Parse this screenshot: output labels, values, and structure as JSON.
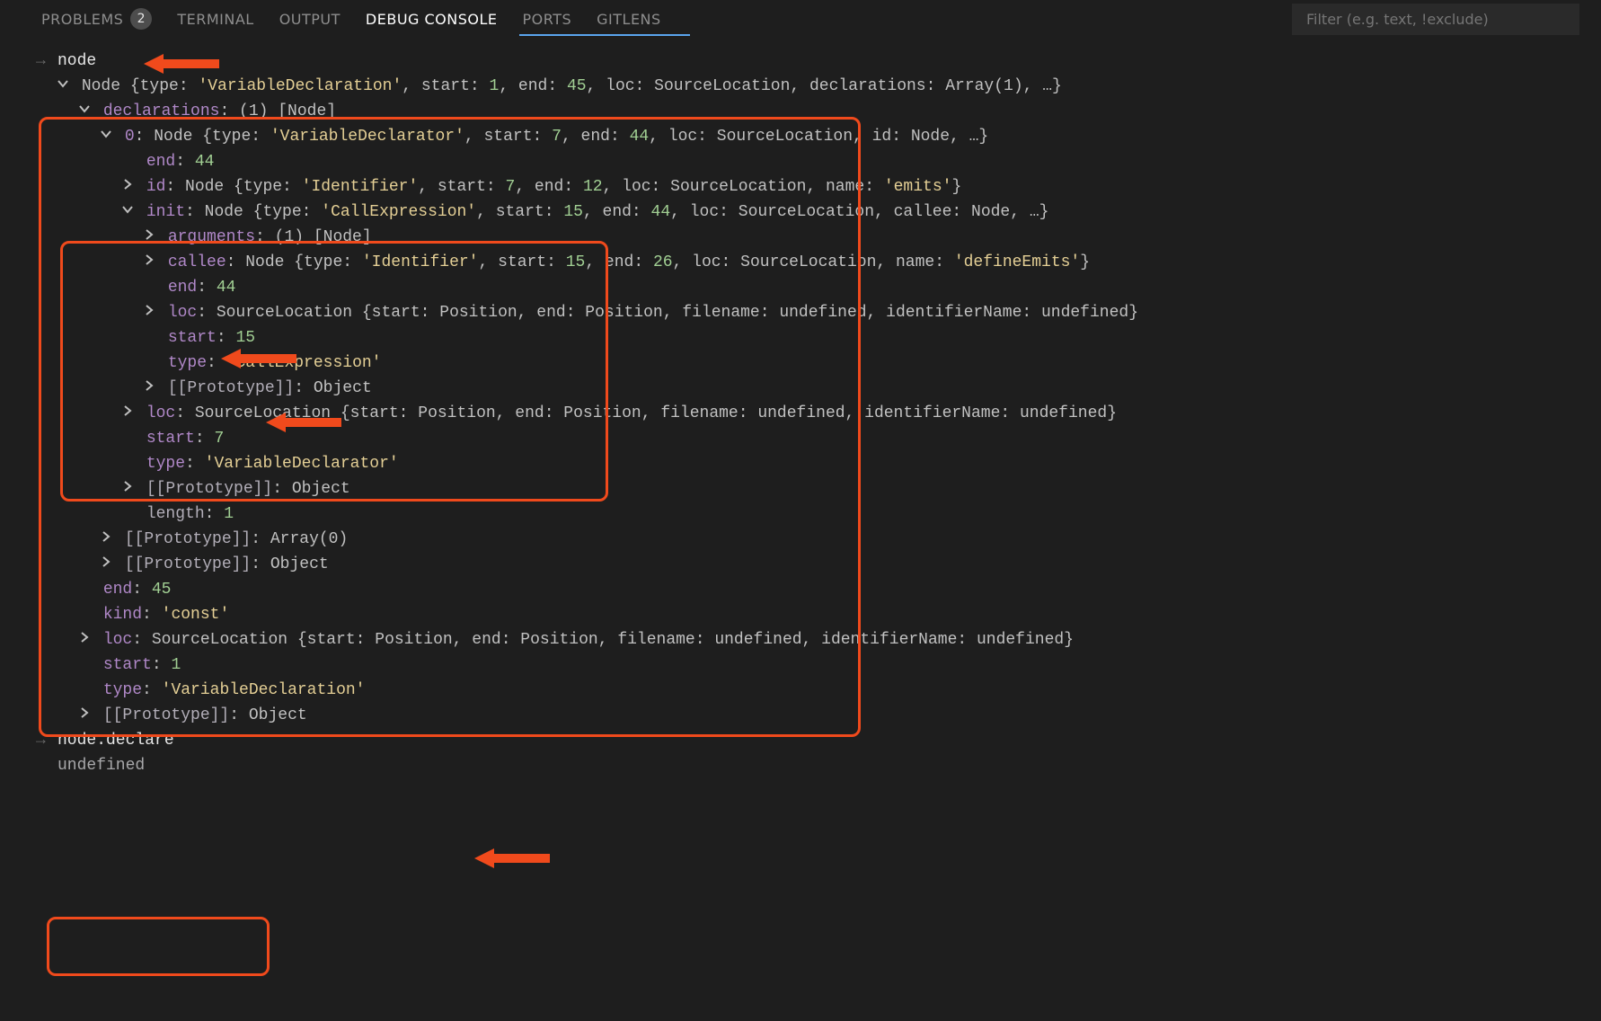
{
  "tabs": {
    "problems": "PROBLEMS",
    "problems_badge": "2",
    "terminal": "TERMINAL",
    "output": "OUTPUT",
    "debug_console": "DEBUG CONSOLE",
    "ports": "PORTS",
    "gitlens": "GITLENS"
  },
  "filter_placeholder": "Filter (e.g. text, !exclude)",
  "input1": "node",
  "root_summary": {
    "prefix": "Node {type: ",
    "type_str": "'VariableDeclaration'",
    "mid1": ", start: ",
    "start": "1",
    "mid2": ", end: ",
    "end": "45",
    "mid3": ", loc: SourceLocation, declarations: Array(1), …}"
  },
  "decl_head": {
    "key": "declarations",
    "meta": " (1) [Node]"
  },
  "decl0_summary": {
    "key": "0",
    "prefix": "Node {type: ",
    "type_str": "'VariableDeclarator'",
    "mid1": ", start: ",
    "start": "7",
    "mid2": ", end: ",
    "end": "44",
    "mid3": ", loc: SourceLocation, id: Node, …}"
  },
  "decl0_end": {
    "key": "end",
    "val": "44"
  },
  "decl0_id": {
    "key": "id",
    "prefix": "Node {type: ",
    "type_str": "'Identifier'",
    "mid1": ", start: ",
    "start": "7",
    "mid2": ", end: ",
    "end": "12",
    "mid3": ", loc: SourceLocation, name: ",
    "name": "'emits'",
    "tail": "}"
  },
  "init_summary": {
    "key": "init",
    "prefix": "Node {type: ",
    "type_str": "'CallExpression'",
    "mid1": ", start: ",
    "start": "15",
    "mid2": ", end: ",
    "end": "44",
    "mid3": ", loc: SourceLocation, callee: Node, …}"
  },
  "init_args": {
    "key": "arguments",
    "meta": " (1) [Node]"
  },
  "init_callee": {
    "key": "callee",
    "prefix": "Node {type: ",
    "type_str": "'Identifier'",
    "mid1": ", start: ",
    "start": "15",
    "mid2": ", end: ",
    "end": "26",
    "mid3": ", loc: SourceLocation, name: ",
    "name": "'defineEmits'",
    "tail": "}"
  },
  "init_end": {
    "key": "end",
    "val": "44"
  },
  "init_loc": {
    "key": "loc",
    "summary": "SourceLocation {start: Position, end: Position, filename: undefined, identifierName: undefined}"
  },
  "init_start": {
    "key": "start",
    "val": "15"
  },
  "init_type": {
    "key": "type",
    "val": "'CallExpression'"
  },
  "init_proto": {
    "key": "[[Prototype]]",
    "val": "Object"
  },
  "decl0_loc": {
    "key": "loc",
    "summary": "SourceLocation {start: Position, end: Position, filename: undefined, identifierName: undefined}"
  },
  "decl0_start": {
    "key": "start",
    "val": "7"
  },
  "decl0_type": {
    "key": "type",
    "val": "'VariableDeclarator'"
  },
  "decl0_proto": {
    "key": "[[Prototype]]",
    "val": "Object"
  },
  "decl_length": {
    "key": "length",
    "val": "1"
  },
  "decl_proto1": {
    "key": "[[Prototype]]",
    "val": "Array(0)"
  },
  "decl_proto2": {
    "key": "[[Prototype]]",
    "val": "Object"
  },
  "root_end": {
    "key": "end",
    "val": "45"
  },
  "root_kind": {
    "key": "kind",
    "val": "'const'"
  },
  "root_loc": {
    "key": "loc",
    "summary": "SourceLocation {start: Position, end: Position, filename: undefined, identifierName: undefined}"
  },
  "root_start": {
    "key": "start",
    "val": "1"
  },
  "root_type": {
    "key": "type",
    "val": "'VariableDeclaration'"
  },
  "root_proto": {
    "key": "[[Prototype]]",
    "val": "Object"
  },
  "input2": "node.declare",
  "result2": "undefined"
}
